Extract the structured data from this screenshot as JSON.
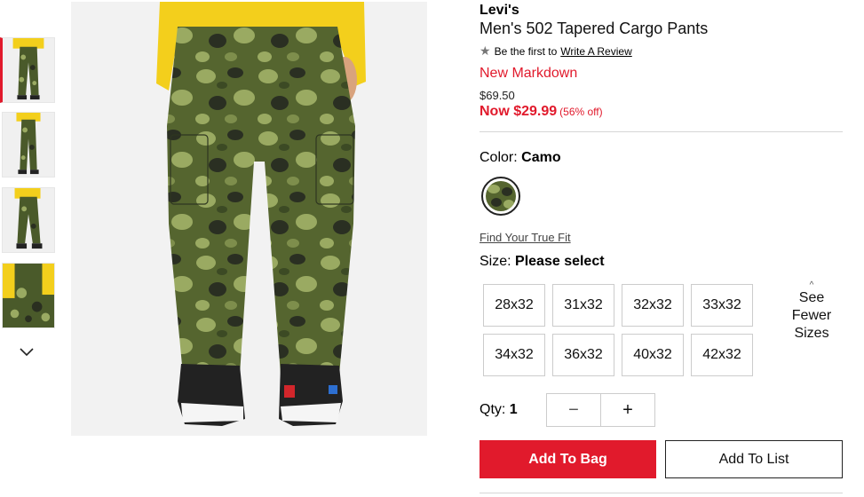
{
  "product": {
    "brand": "Levi's",
    "title": "Men's 502 Tapered Cargo Pants",
    "review_prefix": "Be the first to",
    "review_link": "Write A Review",
    "markdown_label": "New Markdown",
    "original_price": "$69.50",
    "now_price": "Now $29.99",
    "discount": "(56% off)"
  },
  "color": {
    "label": "Color:",
    "selected": "Camo"
  },
  "fit": {
    "link": "Find Your True Fit"
  },
  "size": {
    "label": "Size:",
    "selected": "Please select",
    "options": [
      "28x32",
      "31x32",
      "32x32",
      "33x32",
      "34x32",
      "36x32",
      "40x32",
      "42x32"
    ],
    "toggle": [
      "See",
      "Fewer",
      "Sizes"
    ]
  },
  "quantity": {
    "label": "Qty:",
    "value": "1",
    "decrement": "−",
    "increment": "+"
  },
  "actions": {
    "add_to_bag": "Add To Bag",
    "add_to_list": "Add To List"
  },
  "icons": {
    "star": "star-icon",
    "chevron": "chevron-down-icon",
    "caret": "chevron-up-icon"
  },
  "colors": {
    "accent_red": "#e11a2c",
    "camo_dark": "#3d4a23",
    "camo_light": "#8f9d5a"
  }
}
